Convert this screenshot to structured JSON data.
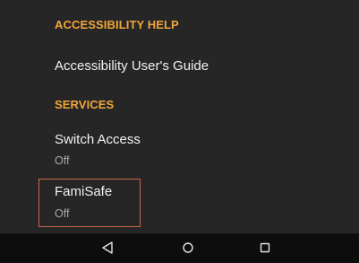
{
  "sections": [
    {
      "header": "ACCESSIBILITY HELP"
    },
    {
      "header": "SERVICES"
    }
  ],
  "items": {
    "guide": {
      "title": "Accessibility User's Guide"
    },
    "switch_access": {
      "title": "Switch Access",
      "status": "Off"
    },
    "famisafe": {
      "title": "FamiSafe",
      "status": "Off"
    }
  },
  "colors": {
    "accent": "#f0a63a",
    "highlight_border": "#c9684a",
    "background": "#262626",
    "navbar": "#0d0d0d"
  },
  "navbar": {
    "icons": [
      "back-icon",
      "home-icon",
      "recents-icon"
    ]
  }
}
